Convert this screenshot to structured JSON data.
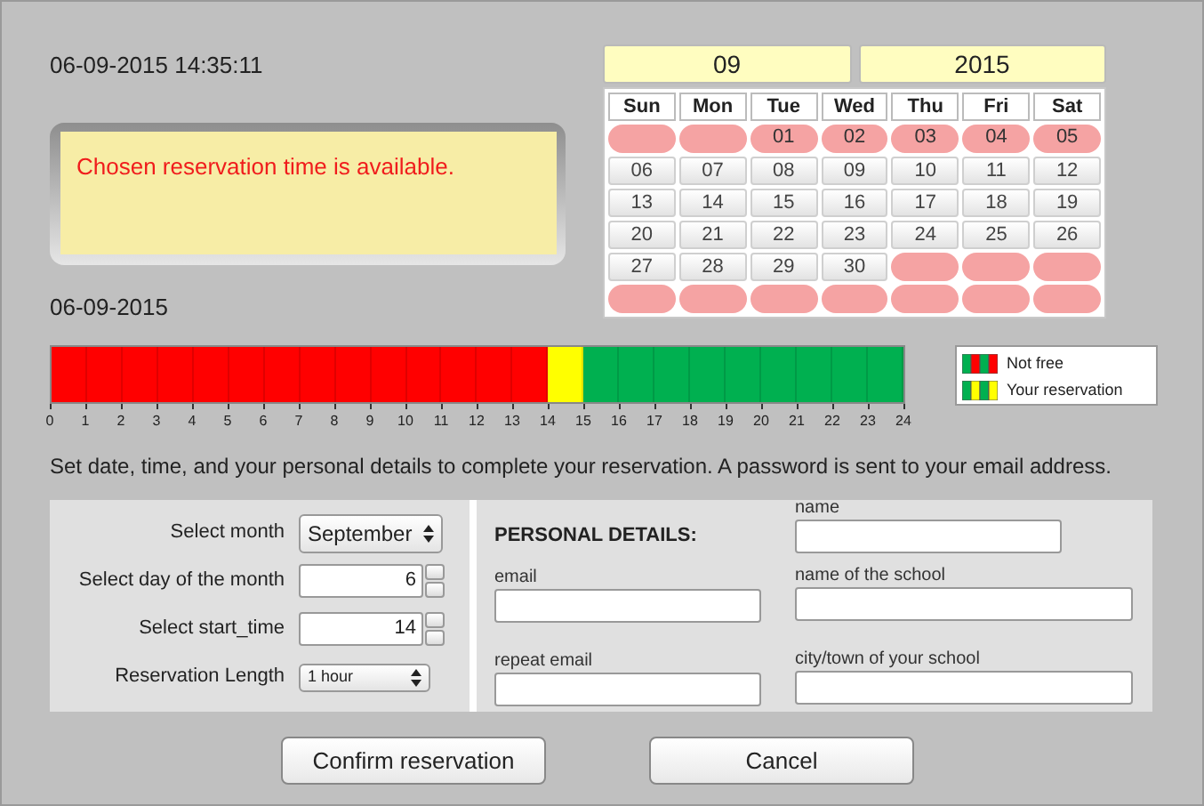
{
  "clock": "06-09-2015 14:35:11",
  "message": "Chosen reservation time is available.",
  "selected_date": "06-09-2015",
  "calendar": {
    "month": "09",
    "year": "2015",
    "weekdays": [
      "Sun",
      "Mon",
      "Tue",
      "Wed",
      "Thu",
      "Fri",
      "Sat"
    ],
    "weeks": [
      [
        {
          "available": false
        },
        {
          "available": false
        },
        {
          "day": "01",
          "available": false
        },
        {
          "day": "02",
          "available": false
        },
        {
          "day": "03",
          "available": false
        },
        {
          "day": "04",
          "available": false
        },
        {
          "day": "05",
          "available": false
        }
      ],
      [
        {
          "day": "06",
          "available": true
        },
        {
          "day": "07",
          "available": true
        },
        {
          "day": "08",
          "available": true
        },
        {
          "day": "09",
          "available": true
        },
        {
          "day": "10",
          "available": true
        },
        {
          "day": "11",
          "available": true
        },
        {
          "day": "12",
          "available": true
        }
      ],
      [
        {
          "day": "13",
          "available": true
        },
        {
          "day": "14",
          "available": true
        },
        {
          "day": "15",
          "available": true
        },
        {
          "day": "16",
          "available": true
        },
        {
          "day": "17",
          "available": true
        },
        {
          "day": "18",
          "available": true
        },
        {
          "day": "19",
          "available": true
        }
      ],
      [
        {
          "day": "20",
          "available": true
        },
        {
          "day": "21",
          "available": true
        },
        {
          "day": "22",
          "available": true
        },
        {
          "day": "23",
          "available": true
        },
        {
          "day": "24",
          "available": true
        },
        {
          "day": "25",
          "available": true
        },
        {
          "day": "26",
          "available": true
        }
      ],
      [
        {
          "day": "27",
          "available": true
        },
        {
          "day": "28",
          "available": true
        },
        {
          "day": "29",
          "available": true
        },
        {
          "day": "30",
          "available": true
        },
        {
          "available": false
        },
        {
          "available": false
        },
        {
          "available": false
        }
      ],
      [
        {
          "available": false
        },
        {
          "available": false
        },
        {
          "available": false
        },
        {
          "available": false
        },
        {
          "available": false
        },
        {
          "available": false
        },
        {
          "available": false
        }
      ]
    ]
  },
  "timeline": {
    "hours": [
      {
        "kind": "booked"
      },
      {
        "kind": "booked"
      },
      {
        "kind": "booked"
      },
      {
        "kind": "booked"
      },
      {
        "kind": "booked"
      },
      {
        "kind": "booked"
      },
      {
        "kind": "booked"
      },
      {
        "kind": "booked"
      },
      {
        "kind": "booked"
      },
      {
        "kind": "booked"
      },
      {
        "kind": "booked"
      },
      {
        "kind": "booked"
      },
      {
        "kind": "booked"
      },
      {
        "kind": "booked"
      },
      {
        "kind": "yours"
      },
      {
        "kind": "free"
      },
      {
        "kind": "free"
      },
      {
        "kind": "free"
      },
      {
        "kind": "free"
      },
      {
        "kind": "free"
      },
      {
        "kind": "free"
      },
      {
        "kind": "free"
      },
      {
        "kind": "free"
      },
      {
        "kind": "free"
      }
    ],
    "ticks": [
      "0",
      "1",
      "2",
      "3",
      "4",
      "5",
      "6",
      "7",
      "8",
      "9",
      "10",
      "11",
      "12",
      "13",
      "14",
      "15",
      "16",
      "17",
      "18",
      "19",
      "20",
      "21",
      "22",
      "23",
      "24"
    ]
  },
  "legend": [
    {
      "label": "Not free",
      "kind": "booked"
    },
    {
      "label": "Your reservation",
      "kind": "yours"
    }
  ],
  "instructions": "Set date, time, and your personal details to complete your reservation. A password is sent to your email address.",
  "settings": [
    {
      "label": "Select month",
      "kind": "select",
      "value": "September"
    },
    {
      "label": "Select day of the month",
      "kind": "spinner",
      "value": "6"
    },
    {
      "label": "Select start_time",
      "kind": "spinner",
      "value": "14"
    },
    {
      "label": "Reservation Length",
      "kind": "dropdown",
      "value": "1 hour"
    }
  ],
  "personal": {
    "title": "PERSONAL DETAILS:",
    "left_fields": [
      {
        "label": "email"
      },
      {
        "label": "repeat email"
      }
    ],
    "right_fields": [
      {
        "label": "name"
      },
      {
        "label": "name of the school"
      },
      {
        "label": "city/town of your school"
      }
    ]
  },
  "buttons": [
    "Confirm reservation",
    "Cancel"
  ]
}
